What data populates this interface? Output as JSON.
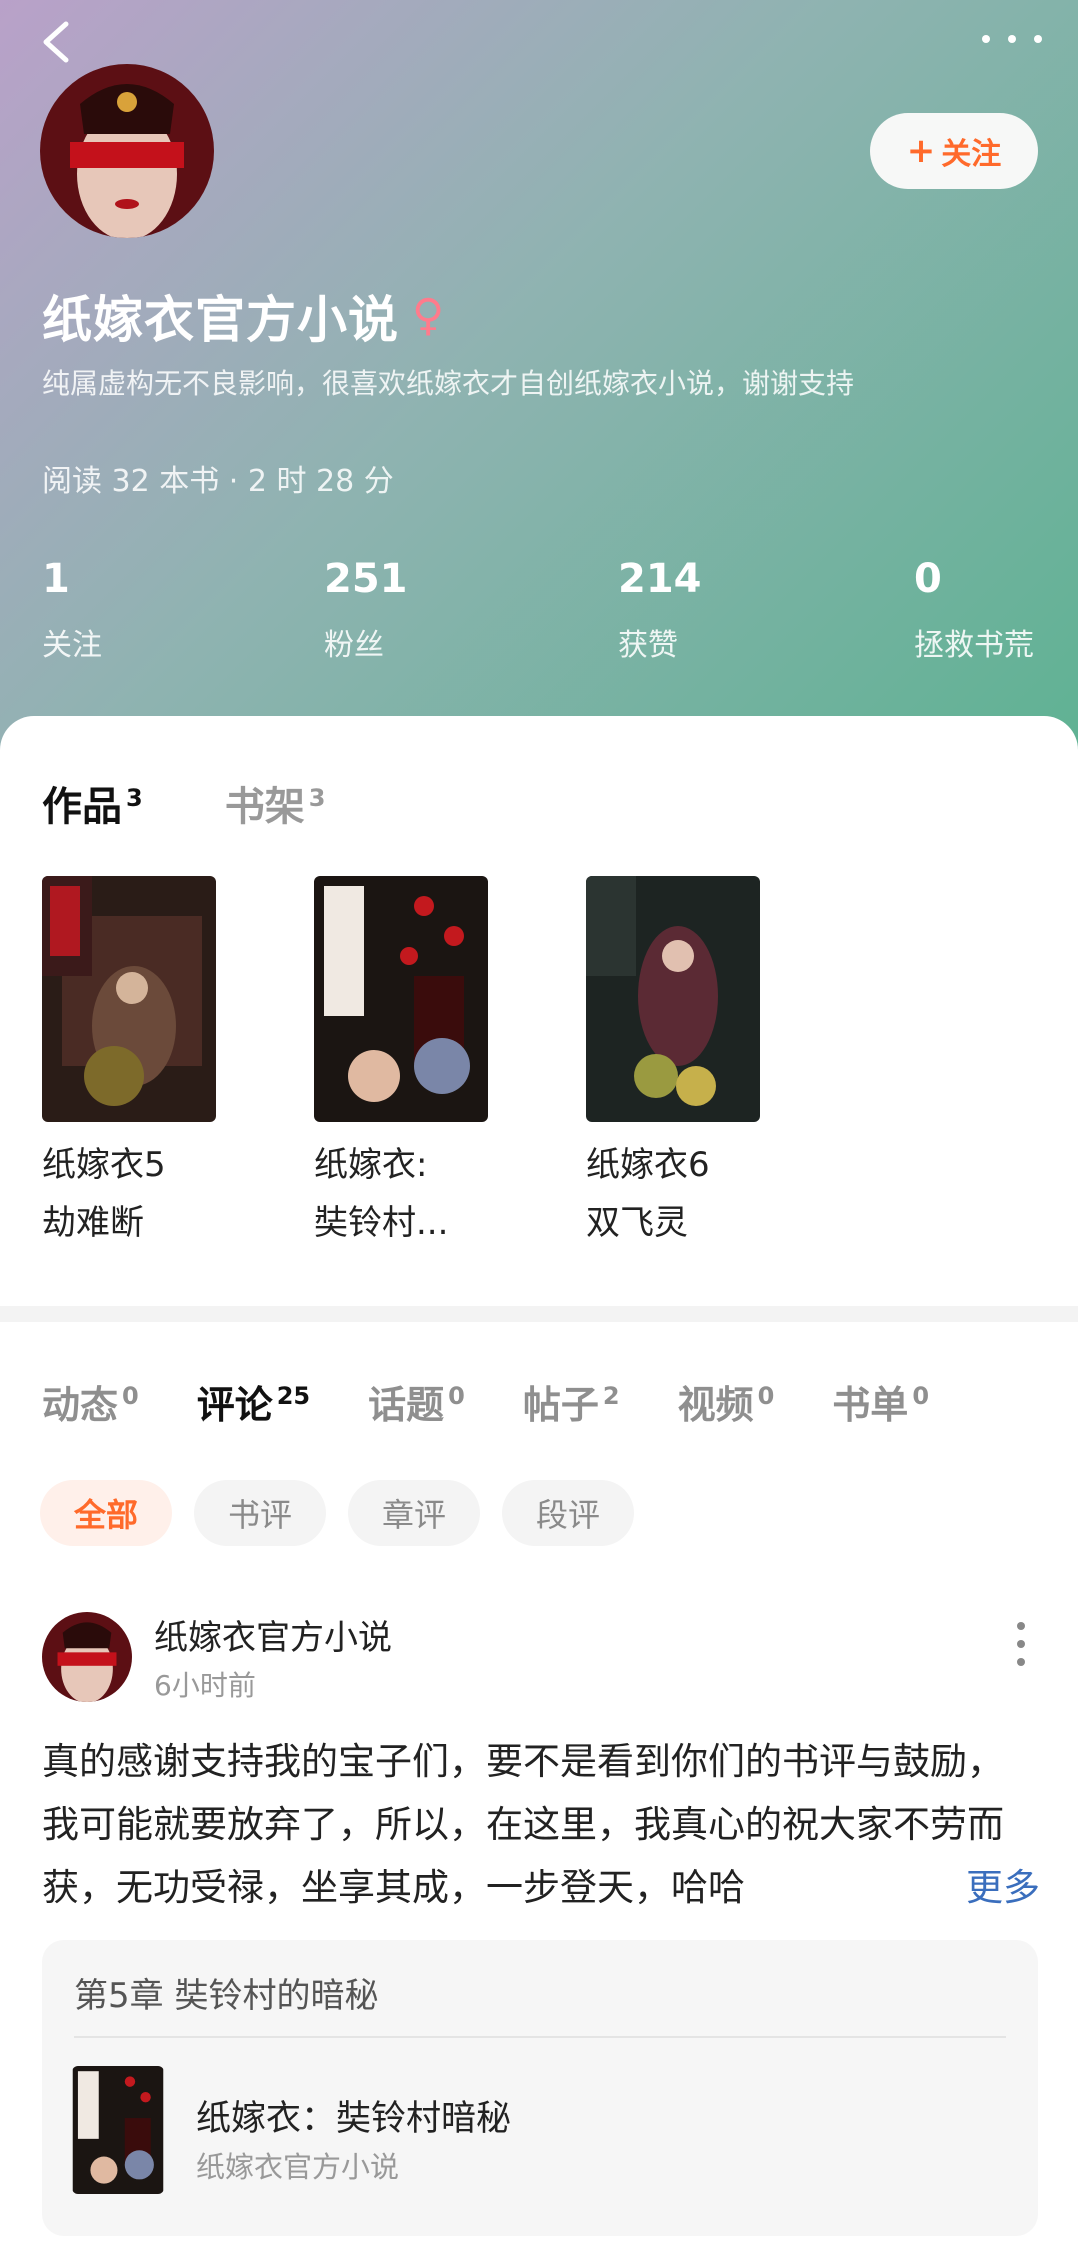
{
  "profile": {
    "name": "纸嫁衣官方小说",
    "gender_symbol": "♀",
    "bio": "纯属虚构无不良影响，很喜欢纸嫁衣才自创纸嫁衣小说，谢谢支持",
    "reading_stats": "阅读 32 本书 · 2 时 28 分",
    "follow_button": "关注",
    "follow_plus": "+"
  },
  "stats": [
    {
      "value": "1",
      "label": "关注"
    },
    {
      "value": "251",
      "label": "粉丝"
    },
    {
      "value": "214",
      "label": "获赞"
    },
    {
      "value": "0",
      "label": "拯救书荒"
    }
  ],
  "works_tabs": [
    {
      "label": "作品",
      "count": "3"
    },
    {
      "label": "书架",
      "count": "3"
    }
  ],
  "books": [
    {
      "title_line1": "纸嫁衣5",
      "title_line2": "劫难断"
    },
    {
      "title_line1": "纸嫁衣:",
      "title_line2": "奘铃村..."
    },
    {
      "title_line1": "纸嫁衣6",
      "title_line2": "双飞灵"
    }
  ],
  "activity_tabs": [
    {
      "label": "动态",
      "count": "0"
    },
    {
      "label": "评论",
      "count": "25"
    },
    {
      "label": "话题",
      "count": "0"
    },
    {
      "label": "帖子",
      "count": "2"
    },
    {
      "label": "视频",
      "count": "0"
    },
    {
      "label": "书单",
      "count": "0"
    }
  ],
  "filter_chips": [
    "全部",
    "书评",
    "章评",
    "段评"
  ],
  "post": {
    "author": "纸嫁衣官方小说",
    "time": "6小时前",
    "body": "真的感谢支持我的宝子们，要不是看到你们的书评与鼓励，我可能就要放弃了，所以，在这里，我真心的祝大家不劳而获，无功受禄，坐享其成，一步登天，哈哈",
    "more_link": "更多",
    "chapter": "第5章 奘铃村的暗秘",
    "ref_book_title": "纸嫁衣：奘铃村暗秘",
    "ref_book_author": "纸嫁衣官方小说"
  },
  "colors": {
    "accent": "#ff6a2b",
    "link": "#3a6ebd"
  }
}
